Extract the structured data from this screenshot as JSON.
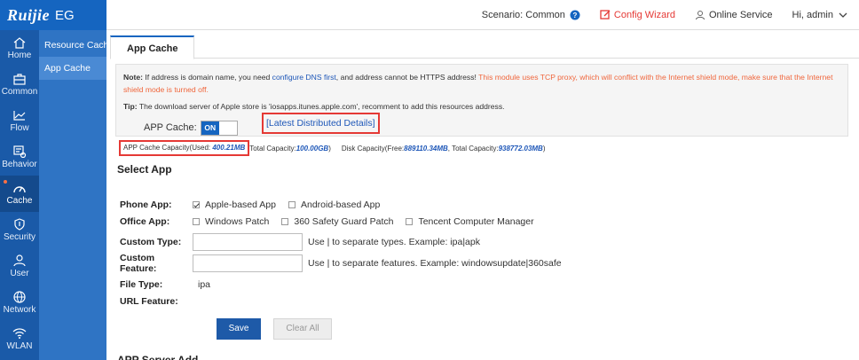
{
  "brand": {
    "logo": "Ruijie",
    "product": "EG"
  },
  "rail": [
    {
      "label": "Home",
      "icon": "home-icon"
    },
    {
      "label": "Common",
      "icon": "briefcase-icon"
    },
    {
      "label": "Flow",
      "icon": "line-chart-icon"
    },
    {
      "label": "Behavior",
      "icon": "behavior-icon"
    },
    {
      "label": "Cache",
      "icon": "gauge-icon",
      "active": true
    },
    {
      "label": "Security",
      "icon": "shield-icon"
    },
    {
      "label": "User",
      "icon": "user-icon"
    },
    {
      "label": "Network",
      "icon": "globe-icon"
    },
    {
      "label": "WLAN",
      "icon": "wifi-icon"
    }
  ],
  "submenu": [
    {
      "label": "Resource Cache"
    },
    {
      "label": "App Cache",
      "active": true
    }
  ],
  "header": {
    "scenario": "Scenario:  Common",
    "config_wizard": "Config Wizard",
    "online_service": "Online Service",
    "user": "Hi, admin"
  },
  "tab": {
    "label": "App Cache"
  },
  "notice": {
    "note_label": "Note:",
    "note_text_1": " If address is domain name, you need ",
    "note_link": "configure DNS first",
    "note_text_2": ", and address cannot be HTTPS address! ",
    "note_warning": "This module uses TCP proxy, which will conflict with the Internet shield mode, make sure that the Internet shield mode is turned off.",
    "tip_label": "Tip:",
    "tip_text": " The download server of Apple store is 'iosapps.itunes.apple.com', recomment to add this resources address."
  },
  "app_cache": {
    "label": "APP Cache:",
    "toggle": "ON",
    "details_link": "[Latest Distributed Details]"
  },
  "capacity": {
    "used_label": "APP Cache Capacity(Used: ",
    "used_value": "400.21MB",
    "total_label": "Total Capacity: ",
    "total_value": "100.00GB",
    "disk_label": "Disk Capacity(Free: ",
    "disk_free": "889110.34MB",
    "disk_total_label": ", Total Capacity: ",
    "disk_total": "938772.03MB"
  },
  "select_app": {
    "title": "Select App",
    "phone_label": "Phone App:",
    "phone_options": [
      {
        "label": "Apple-based App",
        "checked": true
      },
      {
        "label": "Android-based App",
        "checked": false
      }
    ],
    "office_label": "Office App:",
    "office_options": [
      {
        "label": "Windows Patch",
        "checked": false
      },
      {
        "label": "360 Safety Guard Patch",
        "checked": false
      },
      {
        "label": "Tencent Computer Manager",
        "checked": false
      }
    ],
    "custom_type_label": "Custom Type:",
    "custom_type_value": "",
    "custom_type_hint": "Use | to separate types. Example: ipa|apk",
    "custom_feature_label": "Custom Feature:",
    "custom_feature_value": "",
    "custom_feature_hint": "Use | to separate features. Example: windowsupdate|360safe",
    "file_type_label": "File Type:",
    "file_type_value": "ipa",
    "url_feature_label": "URL Feature:"
  },
  "buttons": {
    "save": "Save",
    "clear": "Clear All"
  },
  "next_section": "APP Server Add..."
}
